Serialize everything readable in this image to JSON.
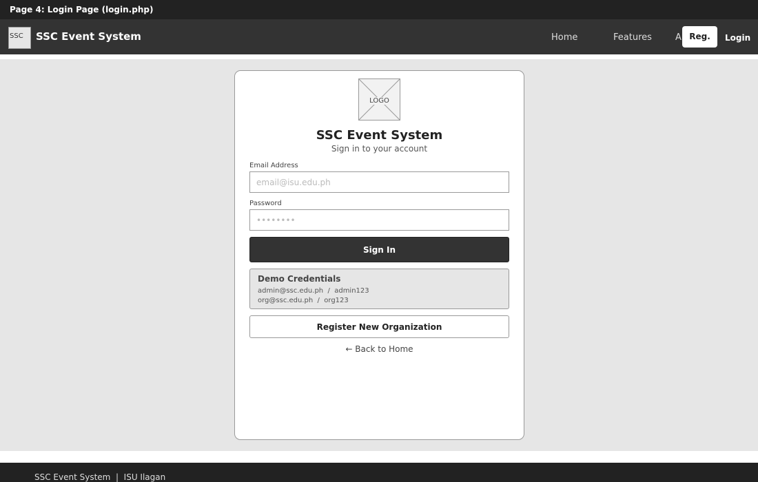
{
  "banner": {
    "text": "Page 4: Login Page (login.php)"
  },
  "navbar": {
    "logo_text": "SSC",
    "brand": "SSC Event System",
    "links": [
      "Home",
      "Features",
      "About"
    ],
    "register_label": "Reg.",
    "login_label": "Login"
  },
  "card": {
    "logo_text": "LOGO",
    "title": "SSC Event System",
    "subtitle": "Sign in to your account",
    "email_label": "Email Address",
    "email_placeholder": "email@isu.edu.ph",
    "password_label": "Password",
    "password_placeholder": "••••••••",
    "signin_label": "Sign In",
    "demo": {
      "title": "Demo Credentials",
      "lines": [
        "admin@ssc.edu.ph  /  admin123",
        "org@ssc.edu.ph  /  org123"
      ]
    },
    "register_label": "Register New Organization",
    "back_label": "← Back to Home"
  },
  "footer": {
    "text": "SSC Event System  |  ISU Ilagan"
  },
  "colors": {
    "banner_bg": "#222222",
    "navbar_bg": "#333333",
    "content_bg": "#e6e6e6",
    "button_dark": "#333333",
    "border": "#999999"
  },
  "icons": {
    "logo": "logo-placeholder-icon"
  }
}
